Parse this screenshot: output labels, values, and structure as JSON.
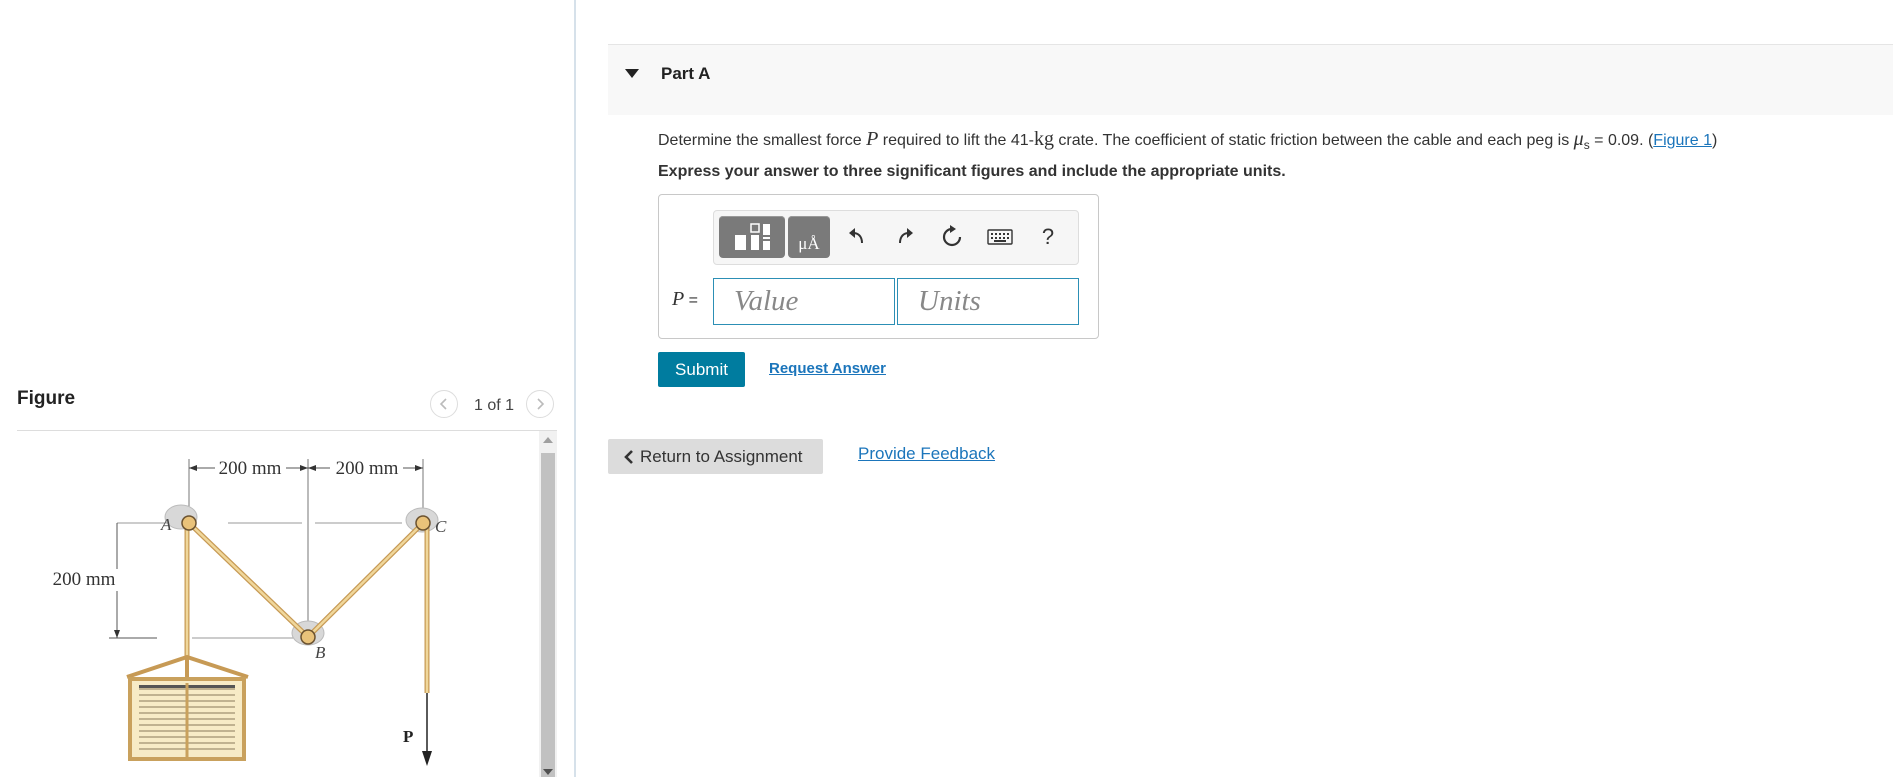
{
  "figure_pane": {
    "title": "Figure",
    "counter": "1 of 1",
    "diagram": {
      "dim_top_left": "200 mm",
      "dim_top_right": "200 mm",
      "dim_left": "200 mm",
      "label_A": "A",
      "label_B": "B",
      "label_C": "C",
      "label_P": "P"
    }
  },
  "part": {
    "label": "Part A",
    "question": {
      "prefix": "Determine the smallest force ",
      "var": "P",
      "mid1": " required to lift the 41-",
      "unit": "kg",
      "mid2": " crate. The coefficient of static friction between the cable and each peg is ",
      "mu": "μ",
      "mu_sub": "s",
      "suffix": " = 0.09. (",
      "figure_link": "Figure 1",
      "close": ")"
    },
    "instructions": "Express your answer to three significant figures and include the appropriate units.",
    "toolbar": {
      "units_tool": "μÅ",
      "help": "?"
    },
    "answer": {
      "var_label": "P",
      "equals": " =",
      "value_placeholder": "Value",
      "units_placeholder": "Units"
    },
    "submit_label": "Submit",
    "request_answer_label": "Request Answer"
  },
  "footer": {
    "return_label": "Return to Assignment",
    "feedback_label": "Provide Feedback"
  }
}
